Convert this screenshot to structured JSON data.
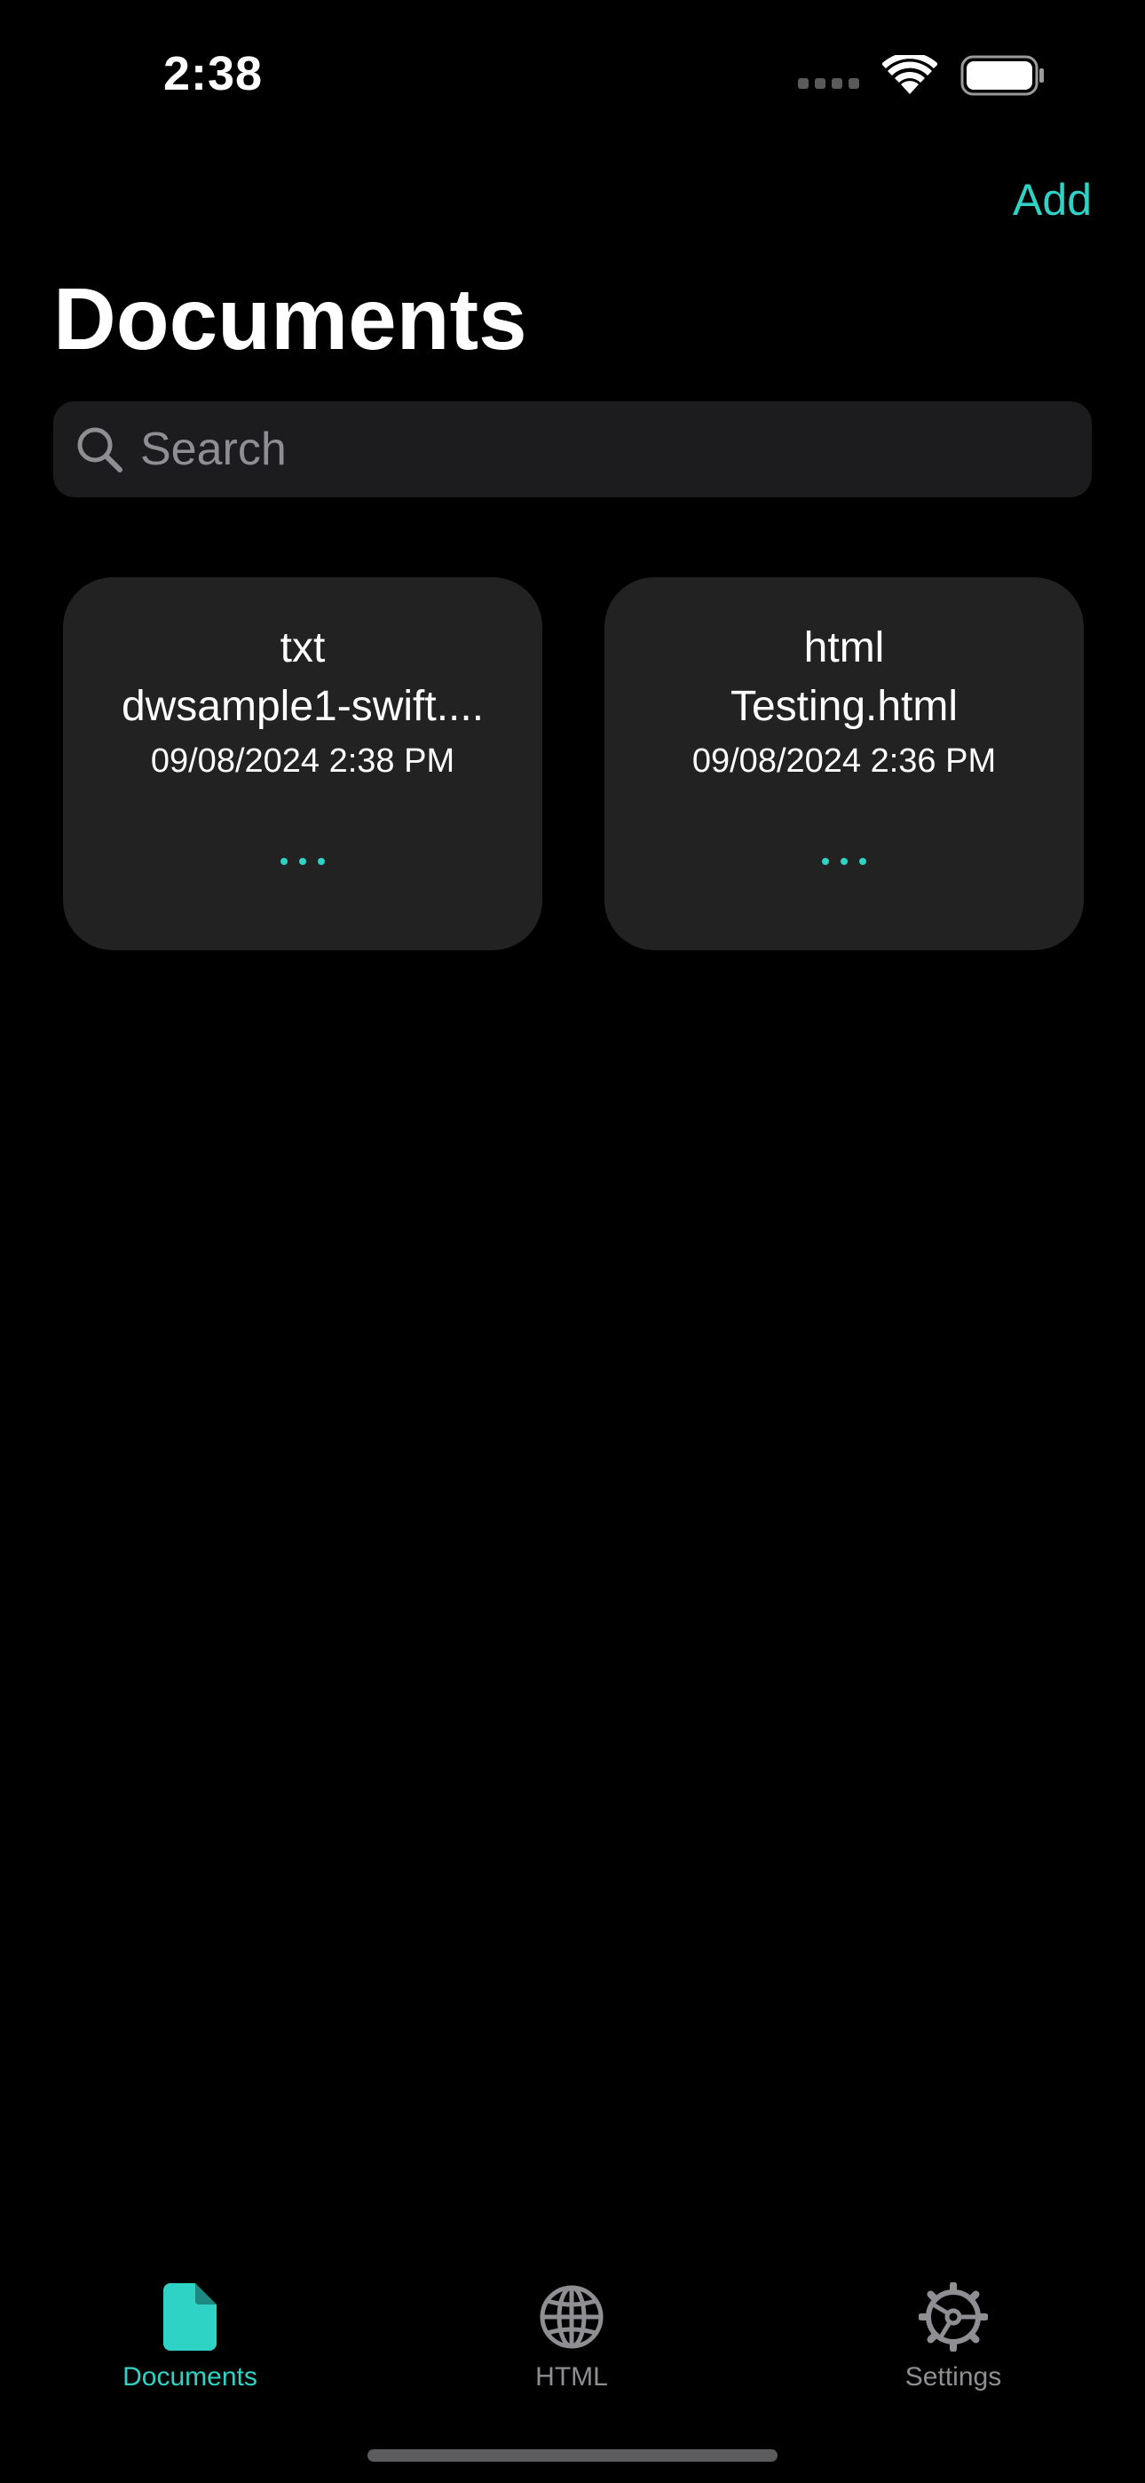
{
  "status_bar": {
    "time": "2:38"
  },
  "nav": {
    "add_label": "Add",
    "title": "Documents"
  },
  "search": {
    "placeholder": "Search"
  },
  "documents": [
    {
      "type": "txt",
      "name": "dwsample1-swift....",
      "date": "09/08/2024 2:38 PM"
    },
    {
      "type": "html",
      "name": "Testing.html",
      "date": "09/08/2024 2:36 PM"
    }
  ],
  "tab_bar": {
    "tabs": [
      {
        "label": "Documents",
        "icon": "document-icon",
        "active": true
      },
      {
        "label": "HTML",
        "icon": "globe-icon",
        "active": false
      },
      {
        "label": "Settings",
        "icon": "gear-icon",
        "active": false
      }
    ]
  },
  "colors": {
    "accent": "#2fd3c6",
    "background": "#000000",
    "card": "#222222",
    "inactive": "#8e8e93"
  }
}
